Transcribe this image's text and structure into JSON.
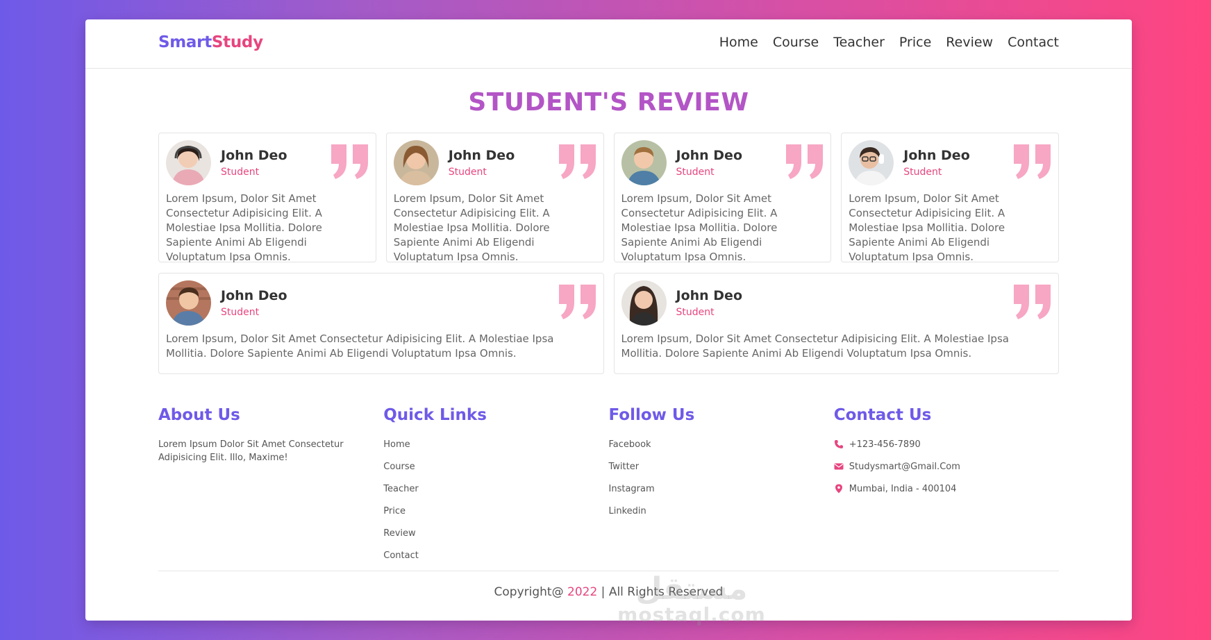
{
  "brand": {
    "part1": "Smart",
    "part2": "Study"
  },
  "nav": [
    "Home",
    "Course",
    "Teacher",
    "Price",
    "Review",
    "Contact"
  ],
  "section_title": "STUDENT'S REVIEW",
  "reviews": [
    {
      "name": "John Deo",
      "role": "Student",
      "text": "Lorem Ipsum, Dolor Sit Amet Consectetur Adipisicing Elit. A Molestiae Ipsa Mollitia. Dolore Sapiente Animi Ab Eligendi Voluptatum Ipsa Omnis."
    },
    {
      "name": "John Deo",
      "role": "Student",
      "text": "Lorem Ipsum, Dolor Sit Amet Consectetur Adipisicing Elit. A Molestiae Ipsa Mollitia. Dolore Sapiente Animi Ab Eligendi Voluptatum Ipsa Omnis."
    },
    {
      "name": "John Deo",
      "role": "Student",
      "text": "Lorem Ipsum, Dolor Sit Amet Consectetur Adipisicing Elit. A Molestiae Ipsa Mollitia. Dolore Sapiente Animi Ab Eligendi Voluptatum Ipsa Omnis."
    },
    {
      "name": "John Deo",
      "role": "Student",
      "text": "Lorem Ipsum, Dolor Sit Amet Consectetur Adipisicing Elit. A Molestiae Ipsa Mollitia. Dolore Sapiente Animi Ab Eligendi Voluptatum Ipsa Omnis."
    },
    {
      "name": "John Deo",
      "role": "Student",
      "text": "Lorem Ipsum, Dolor Sit Amet Consectetur Adipisicing Elit. A Molestiae Ipsa Mollitia. Dolore Sapiente Animi Ab Eligendi Voluptatum Ipsa Omnis."
    },
    {
      "name": "John Deo",
      "role": "Student",
      "text": "Lorem Ipsum, Dolor Sit Amet Consectetur Adipisicing Elit. A Molestiae Ipsa Mollitia. Dolore Sapiente Animi Ab Eligendi Voluptatum Ipsa Omnis."
    }
  ],
  "footer": {
    "about": {
      "title": "About Us",
      "text": "Lorem Ipsum Dolor Sit Amet Consectetur Adipisicing Elit. Illo, Maxime!"
    },
    "quick_links": {
      "title": "Quick Links",
      "items": [
        "Home",
        "Course",
        "Teacher",
        "Price",
        "Review",
        "Contact"
      ]
    },
    "follow": {
      "title": "Follow Us",
      "items": [
        "Facebook",
        "Twitter",
        "Instagram",
        "Linkedin"
      ]
    },
    "contact": {
      "title": "Contact Us",
      "phone": "+123-456-7890",
      "email": "Studysmart@Gmail.Com",
      "address": "Mumbai, India - 400104"
    }
  },
  "copyright": {
    "prefix": "Copyright@ ",
    "year": "2022",
    "suffix": " | All Rights Reserved"
  },
  "watermark": {
    "arabic": "مستقل",
    "latin": "mostaql.com"
  },
  "icons": {
    "quote": "quote-icon",
    "phone": "phone-icon",
    "email": "envelope-icon",
    "location": "map-pin-icon"
  },
  "colors": {
    "primary": "#6e5ae8",
    "accent": "#e7457f",
    "title": "#b355c6",
    "quote": "#f7a6c4"
  }
}
